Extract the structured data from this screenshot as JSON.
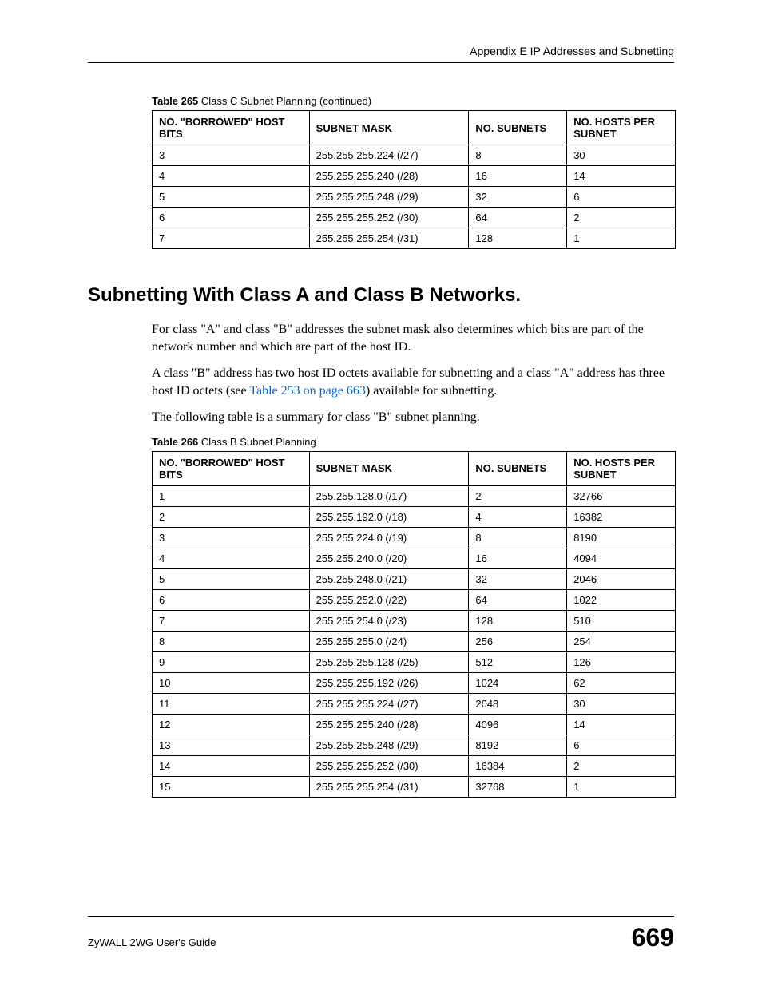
{
  "header": {
    "appendix": "Appendix E IP Addresses and Subnetting"
  },
  "table265": {
    "caption_bold": "Table 265",
    "caption_rest": "   Class C Subnet Planning (continued)",
    "headers": {
      "c1": "NO. \"BORROWED\" HOST BITS",
      "c2": "SUBNET MASK",
      "c3": "NO. SUBNETS",
      "c4": "NO. HOSTS PER SUBNET"
    },
    "rows": [
      {
        "c1": "3",
        "c2": "255.255.255.224 (/27)",
        "c3": "8",
        "c4": "30"
      },
      {
        "c1": "4",
        "c2": "255.255.255.240 (/28)",
        "c3": "16",
        "c4": "14"
      },
      {
        "c1": "5",
        "c2": "255.255.255.248 (/29)",
        "c3": "32",
        "c4": "6"
      },
      {
        "c1": "6",
        "c2": "255.255.255.252 (/30)",
        "c3": "64",
        "c4": "2"
      },
      {
        "c1": "7",
        "c2": "255.255.255.254 (/31)",
        "c3": "128",
        "c4": "1"
      }
    ]
  },
  "section": {
    "heading": "Subnetting With Class A and Class B Networks.",
    "p1": "For class \"A\" and class \"B\" addresses the subnet mask also determines which bits are part of the network number and which are part of the host ID.",
    "p2a": "A class \"B\" address has two host ID octets available for subnetting and a class \"A\" address has three host ID octets (see ",
    "p2link": "Table 253 on page 663",
    "p2b": ") available for subnetting.",
    "p3": "The following table is a summary for class \"B\" subnet planning."
  },
  "table266": {
    "caption_bold": "Table 266",
    "caption_rest": "   Class B Subnet Planning",
    "headers": {
      "c1": "NO. \"BORROWED\" HOST BITS",
      "c2": "SUBNET MASK",
      "c3": "NO. SUBNETS",
      "c4": "NO. HOSTS PER SUBNET"
    },
    "rows": [
      {
        "c1": "1",
        "c2": "255.255.128.0 (/17)",
        "c3": "2",
        "c4": "32766"
      },
      {
        "c1": "2",
        "c2": "255.255.192.0 (/18)",
        "c3": "4",
        "c4": "16382"
      },
      {
        "c1": "3",
        "c2": "255.255.224.0 (/19)",
        "c3": "8",
        "c4": "8190"
      },
      {
        "c1": "4",
        "c2": "255.255.240.0 (/20)",
        "c3": "16",
        "c4": "4094"
      },
      {
        "c1": "5",
        "c2": "255.255.248.0 (/21)",
        "c3": "32",
        "c4": "2046"
      },
      {
        "c1": "6",
        "c2": "255.255.252.0 (/22)",
        "c3": "64",
        "c4": "1022"
      },
      {
        "c1": "7",
        "c2": "255.255.254.0 (/23)",
        "c3": "128",
        "c4": "510"
      },
      {
        "c1": "8",
        "c2": "255.255.255.0 (/24)",
        "c3": "256",
        "c4": "254"
      },
      {
        "c1": "9",
        "c2": "255.255.255.128 (/25)",
        "c3": "512",
        "c4": "126"
      },
      {
        "c1": "10",
        "c2": "255.255.255.192 (/26)",
        "c3": "1024",
        "c4": "62"
      },
      {
        "c1": "11",
        "c2": "255.255.255.224 (/27)",
        "c3": "2048",
        "c4": "30"
      },
      {
        "c1": "12",
        "c2": "255.255.255.240 (/28)",
        "c3": "4096",
        "c4": "14"
      },
      {
        "c1": "13",
        "c2": "255.255.255.248 (/29)",
        "c3": "8192",
        "c4": "6"
      },
      {
        "c1": "14",
        "c2": "255.255.255.252 (/30)",
        "c3": "16384",
        "c4": "2"
      },
      {
        "c1": "15",
        "c2": "255.255.255.254 (/31)",
        "c3": "32768",
        "c4": "1"
      }
    ]
  },
  "footer": {
    "guide": "ZyWALL 2WG User's Guide",
    "page": "669"
  },
  "chart_data": [
    {
      "type": "table",
      "title": "Table 265 Class C Subnet Planning (continued)",
      "columns": [
        "No. \"Borrowed\" Host Bits",
        "Subnet Mask",
        "No. Subnets",
        "No. Hosts Per Subnet"
      ],
      "rows": [
        [
          3,
          "255.255.255.224 (/27)",
          8,
          30
        ],
        [
          4,
          "255.255.255.240 (/28)",
          16,
          14
        ],
        [
          5,
          "255.255.255.248 (/29)",
          32,
          6
        ],
        [
          6,
          "255.255.255.252 (/30)",
          64,
          2
        ],
        [
          7,
          "255.255.255.254 (/31)",
          128,
          1
        ]
      ]
    },
    {
      "type": "table",
      "title": "Table 266 Class B Subnet Planning",
      "columns": [
        "No. \"Borrowed\" Host Bits",
        "Subnet Mask",
        "No. Subnets",
        "No. Hosts Per Subnet"
      ],
      "rows": [
        [
          1,
          "255.255.128.0 (/17)",
          2,
          32766
        ],
        [
          2,
          "255.255.192.0 (/18)",
          4,
          16382
        ],
        [
          3,
          "255.255.224.0 (/19)",
          8,
          8190
        ],
        [
          4,
          "255.255.240.0 (/20)",
          16,
          4094
        ],
        [
          5,
          "255.255.248.0 (/21)",
          32,
          2046
        ],
        [
          6,
          "255.255.252.0 (/22)",
          64,
          1022
        ],
        [
          7,
          "255.255.254.0 (/23)",
          128,
          510
        ],
        [
          8,
          "255.255.255.0 (/24)",
          256,
          254
        ],
        [
          9,
          "255.255.255.128 (/25)",
          512,
          126
        ],
        [
          10,
          "255.255.255.192 (/26)",
          1024,
          62
        ],
        [
          11,
          "255.255.255.224 (/27)",
          2048,
          30
        ],
        [
          12,
          "255.255.255.240 (/28)",
          4096,
          14
        ],
        [
          13,
          "255.255.255.248 (/29)",
          8192,
          6
        ],
        [
          14,
          "255.255.255.252 (/30)",
          16384,
          2
        ],
        [
          15,
          "255.255.255.254 (/31)",
          32768,
          1
        ]
      ]
    }
  ]
}
